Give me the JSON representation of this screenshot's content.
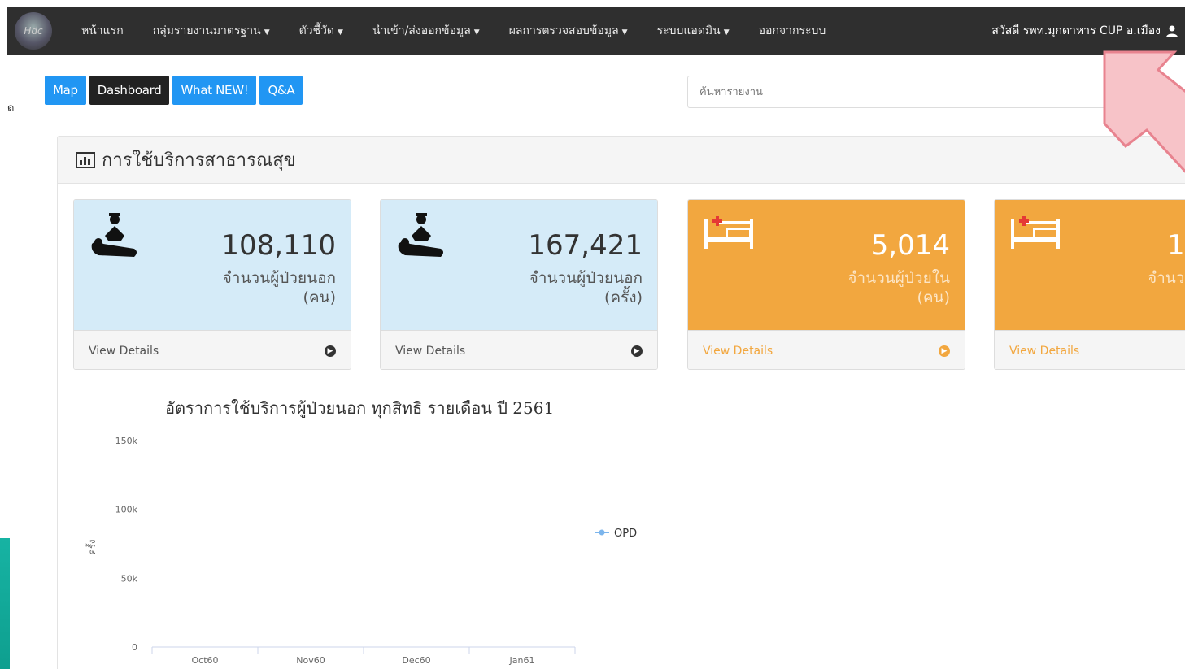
{
  "navbar": {
    "logo_text": "Hdc",
    "items": [
      {
        "label": "หน้าแรก",
        "dropdown": false
      },
      {
        "label": "กลุ่มรายงานมาตรฐาน",
        "dropdown": true
      },
      {
        "label": "ตัวชี้วัด",
        "dropdown": true
      },
      {
        "label": "นำเข้า/ส่งออกข้อมูล",
        "dropdown": true
      },
      {
        "label": "ผลการตรวจสอบข้อมูล",
        "dropdown": true
      },
      {
        "label": "ระบบแอดมิน",
        "dropdown": true
      },
      {
        "label": "ออกจากระบบ",
        "dropdown": false
      }
    ],
    "user_label": "สวัสดี รพท.มุกดาหาร CUP อ.เมือง",
    "user_icon": "user-icon"
  },
  "left_char": "ด",
  "tabs": [
    "Map",
    "Dashboard",
    "What NEW!",
    "Q&A"
  ],
  "search": {
    "placeholder": "ค้นหารายงาน"
  },
  "panel": {
    "title": "การใช้บริการสาธารณสุข",
    "icon": "bar-chart-icon"
  },
  "cards": [
    {
      "value": "108,110",
      "label_line1": "จำนวนผู้ป่วยนอก",
      "label_line2": "(คน)",
      "footer": "View Details",
      "icon": "doctor-patient-icon",
      "color": "#d5ebf8"
    },
    {
      "value": "167,421",
      "label_line1": "จำนวนผู้ป่วยนอก",
      "label_line2": "(ครั้ง)",
      "footer": "View Details",
      "icon": "doctor-patient-icon",
      "color": "#d5ebf8"
    },
    {
      "value": "5,014",
      "label_line1": "จำนวนผู้ป่วยใน",
      "label_line2": "(คน)",
      "footer": "View Details",
      "icon": "hospital-bed-icon",
      "color": "#f2a73f"
    },
    {
      "value": "1",
      "label_line1": "จำนว",
      "label_line2": "",
      "footer": "View Details",
      "icon": "hospital-bed-icon",
      "color": "#f2a73f"
    }
  ],
  "chart_data": {
    "type": "line",
    "title": "อัตราการใช้บริการผู้ป่วยนอก ทุกสิทธิ รายเดือน ปี 2561",
    "ylabel": "ครั้ง",
    "categories": [
      "Oct60",
      "Nov60",
      "Dec60",
      "Jan61"
    ],
    "yticks": [
      "150k",
      "100k",
      "50k",
      "0"
    ],
    "ylim": [
      0,
      150000
    ],
    "series": [
      {
        "name": "OPD",
        "values": [],
        "color": "#7cb5ec"
      }
    ],
    "legend": "right"
  }
}
